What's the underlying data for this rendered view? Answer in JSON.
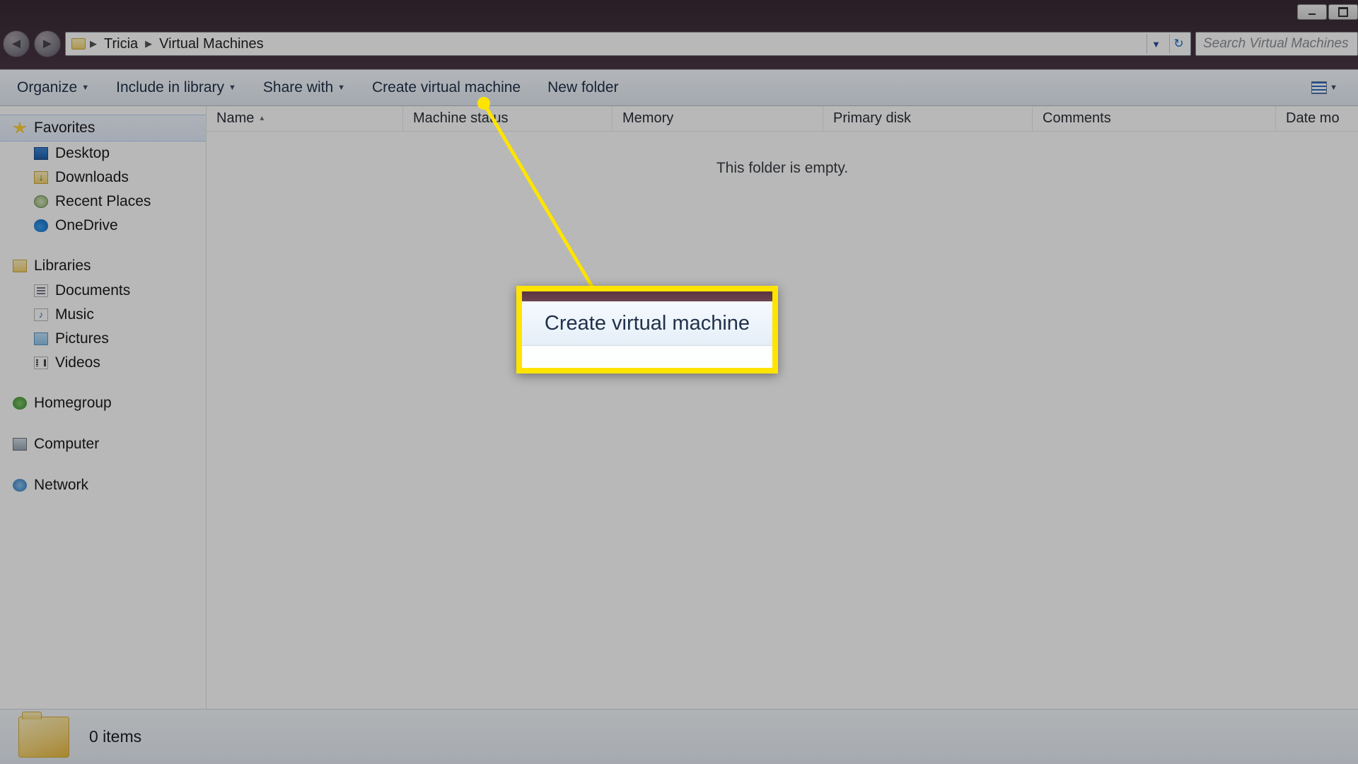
{
  "titlebar": {
    "minimize": "–",
    "maximize": "❐"
  },
  "nav": {
    "back_aria": "Back",
    "forward_aria": "Forward",
    "crumbs": [
      "Tricia",
      "Virtual Machines"
    ],
    "search_placeholder": "Search Virtual Machines",
    "refresh_aria": "Refresh"
  },
  "toolbar": {
    "organize": "Organize",
    "include": "Include in library",
    "share": "Share with",
    "create_vm": "Create virtual machine",
    "new_folder": "New folder",
    "view_aria": "Change your view"
  },
  "sidebar": {
    "favorites": "Favorites",
    "desktop": "Desktop",
    "downloads": "Downloads",
    "recent": "Recent Places",
    "onedrive": "OneDrive",
    "libraries": "Libraries",
    "documents": "Documents",
    "music": "Music",
    "pictures": "Pictures",
    "videos": "Videos",
    "homegroup": "Homegroup",
    "computer": "Computer",
    "network": "Network"
  },
  "columns": {
    "name": "Name",
    "status": "Machine status",
    "memory": "Memory",
    "primary_disk": "Primary disk",
    "comments": "Comments",
    "date_modified": "Date mo"
  },
  "content": {
    "empty": "This folder is empty."
  },
  "status": {
    "items": "0 items"
  },
  "callout": {
    "label": "Create virtual machine"
  },
  "colors": {
    "highlight": "#ffe400",
    "toolbar_text": "#20314a"
  }
}
